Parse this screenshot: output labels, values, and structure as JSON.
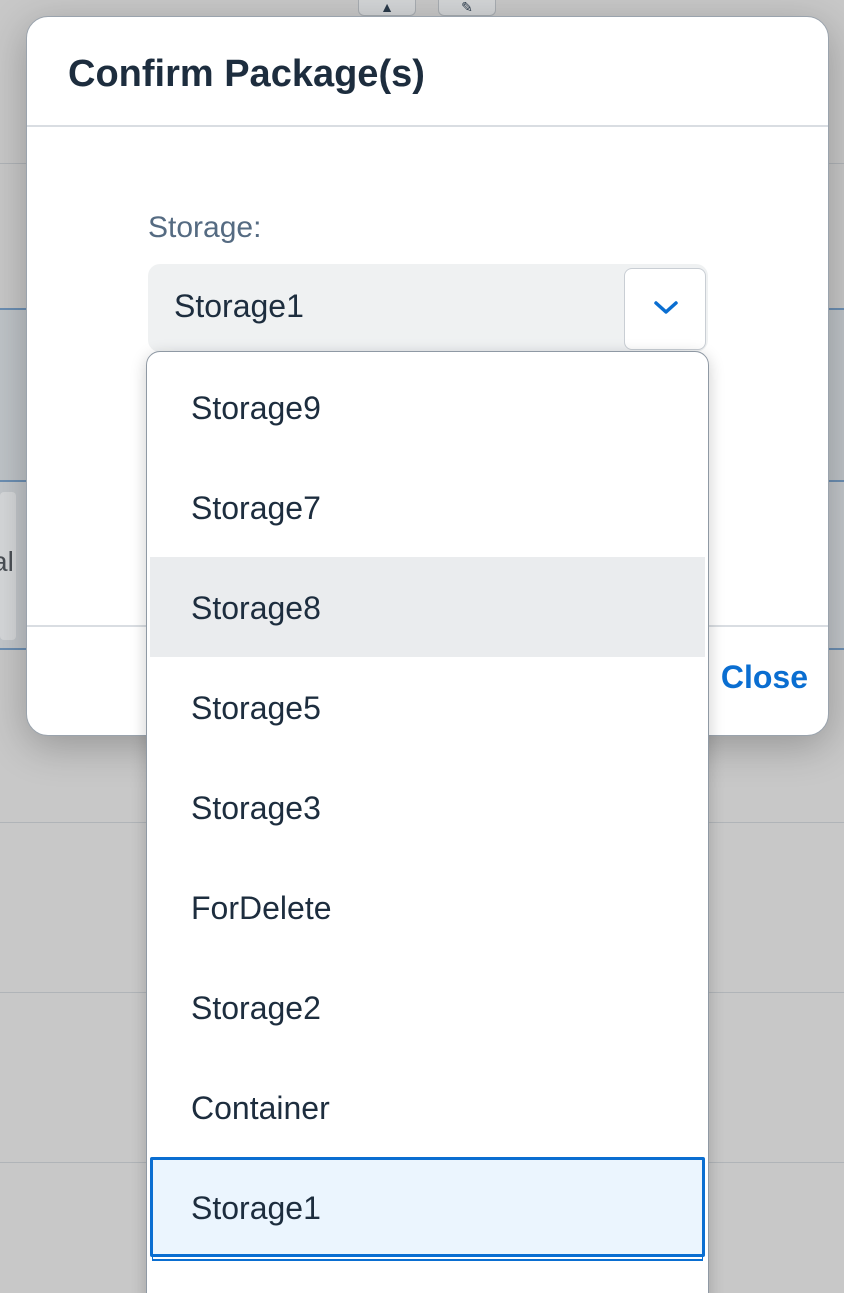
{
  "dialog": {
    "title": "Confirm Package(s)",
    "storage_label": "Storage:",
    "storage_value": "Storage1",
    "close_label": "Close"
  },
  "dropdown": {
    "options": [
      {
        "label": "Storage9",
        "state": "normal"
      },
      {
        "label": "Storage7",
        "state": "normal"
      },
      {
        "label": "Storage8",
        "state": "hovered"
      },
      {
        "label": "Storage5",
        "state": "normal"
      },
      {
        "label": "Storage3",
        "state": "normal"
      },
      {
        "label": "ForDelete",
        "state": "normal"
      },
      {
        "label": "Storage2",
        "state": "normal"
      },
      {
        "label": "Container",
        "state": "normal"
      },
      {
        "label": "Storage1",
        "state": "selected"
      }
    ]
  },
  "background": {
    "edge_text": "al"
  },
  "colors": {
    "accent": "#0a6ed1",
    "title_text": "#1d2d3e",
    "label_text": "#556b82",
    "selected_bg": "#ebf5fe",
    "hover_bg": "#eaecee"
  },
  "icons": {
    "dropdown_arrow": "chevron-down-icon"
  }
}
